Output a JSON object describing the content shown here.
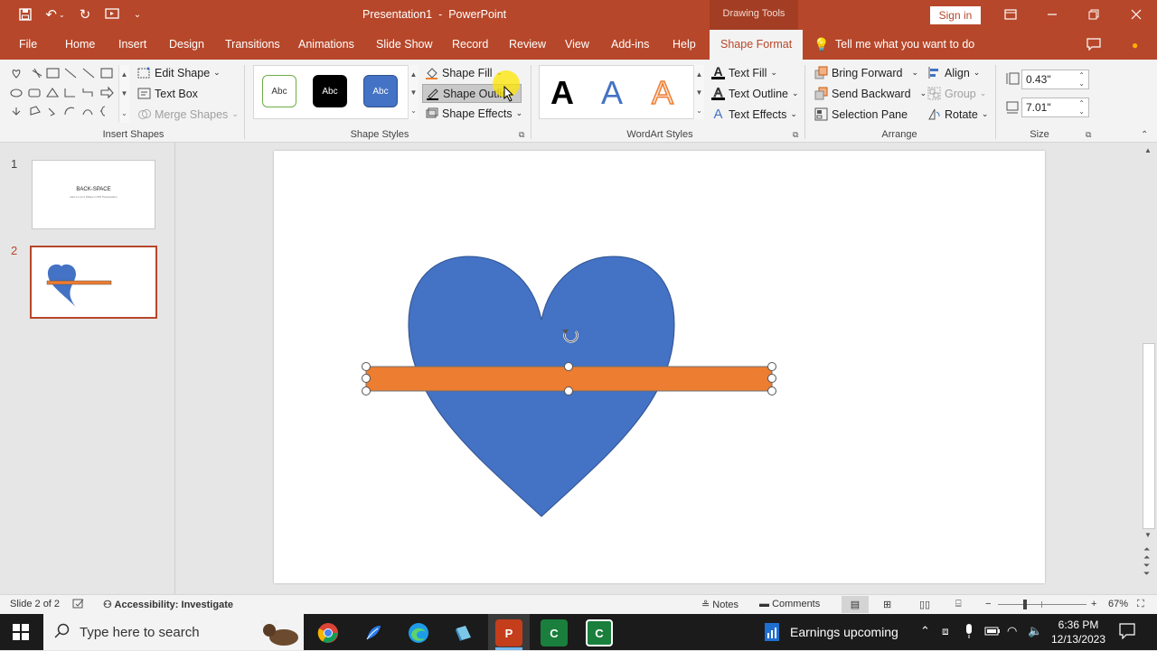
{
  "title_bar": {
    "document_title": "Presentation1  -  PowerPoint",
    "context_label": "Drawing Tools",
    "sign_in": "Sign in"
  },
  "tabs": [
    "File",
    "Home",
    "Insert",
    "Design",
    "Transitions",
    "Animations",
    "Slide Show",
    "Record",
    "Review",
    "View",
    "Add-ins",
    "Help",
    "Shape Format"
  ],
  "tell_me": "Tell me what you want to do",
  "ribbon": {
    "insert_shapes": {
      "label": "Insert Shapes",
      "edit_shape": "Edit Shape",
      "text_box": "Text Box",
      "merge_shapes": "Merge Shapes"
    },
    "shape_styles": {
      "label": "Shape Styles",
      "abc": "Abc",
      "shape_fill": "Shape Fill",
      "shape_outline": "Shape Outline",
      "shape_effects": "Shape Effects"
    },
    "wordart_styles": {
      "label": "WordArt Styles",
      "letter": "A",
      "text_fill": "Text Fill",
      "text_outline": "Text Outline",
      "text_effects": "Text Effects"
    },
    "arrange": {
      "label": "Arrange",
      "bring_forward": "Bring Forward",
      "send_backward": "Send Backward",
      "selection_pane": "Selection Pane",
      "align": "Align",
      "group": "Group",
      "rotate": "Rotate"
    },
    "size": {
      "label": "Size",
      "height": "0.43\"",
      "width": "7.01\""
    }
  },
  "thumbnails": [
    {
      "number": "1",
      "title": "BACK-SPACE",
      "subtitle": "How to cut a Shape in MS Presentation"
    },
    {
      "number": "2"
    }
  ],
  "status_bar": {
    "slide_info": "Slide 2 of 2",
    "accessibility": "Accessibility: Investigate",
    "notes": "Notes",
    "comments": "Comments",
    "zoom": "67%"
  },
  "taskbar": {
    "search_placeholder": "Type here to search",
    "news": "Earnings upcoming",
    "time": "6:36 PM",
    "date": "12/13/2023"
  },
  "colors": {
    "accent": "#b7472a",
    "heart": "#4472c4",
    "bar": "#ed7d31"
  }
}
